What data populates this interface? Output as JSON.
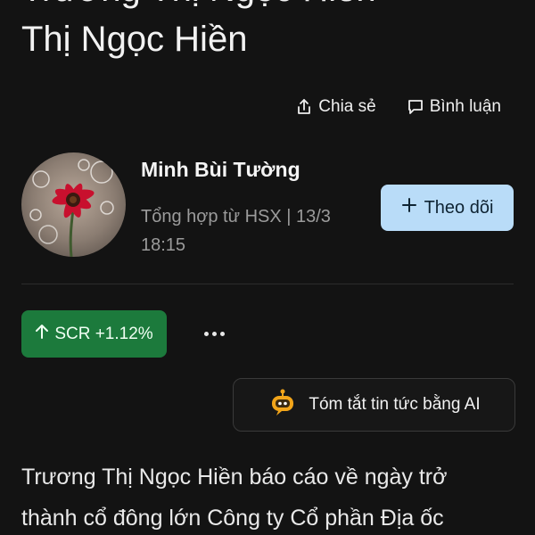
{
  "article": {
    "title_lines": [
      "Trương Thị Ngọc Hiền",
      "Thị Ngọc Hiền"
    ],
    "body_lines": [
      "Trương Thị Ngọc Hiền báo cáo về ngày trở",
      "thành cổ đông lớn Công ty Cổ phần Địa ốc"
    ]
  },
  "actions": {
    "share_label": "Chia sẻ",
    "comment_label": "Bình luận"
  },
  "author": {
    "name": "Minh Bùi Tường",
    "meta_line1": "Tổng hợp từ HSX | 13/3",
    "meta_line2": "18:15",
    "follow_label": "Theo dõi"
  },
  "ticker": {
    "label": "SCR +1.12%",
    "color": "#1c7a3c"
  },
  "ai_summary": {
    "label": "Tóm tắt tin tức bằng AI"
  },
  "icons": {
    "share": "share-icon",
    "comment": "comment-icon",
    "plus": "plus-icon",
    "arrow_up": "arrow-up-icon",
    "more": "more-icon",
    "ai": "ai-bot-icon"
  }
}
